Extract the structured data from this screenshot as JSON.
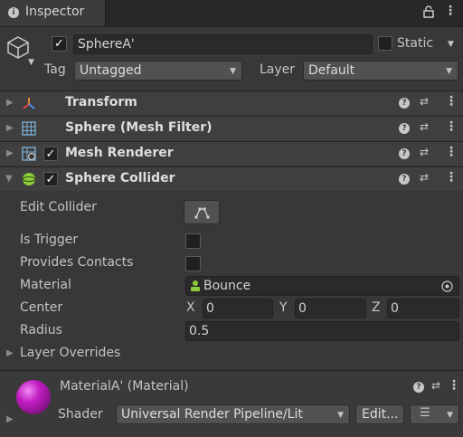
{
  "tab": {
    "title": "Inspector"
  },
  "object": {
    "name": "SphereA'",
    "active": true,
    "static_label": "Static",
    "tag_label": "Tag",
    "tag_value": "Untagged",
    "layer_label": "Layer",
    "layer_value": "Default"
  },
  "components": [
    {
      "title": "Transform",
      "expanded": false,
      "has_checkbox": false
    },
    {
      "title": "Sphere (Mesh Filter)",
      "expanded": false,
      "has_checkbox": false
    },
    {
      "title": "Mesh Renderer",
      "expanded": false,
      "has_checkbox": true,
      "enabled": true
    },
    {
      "title": "Sphere Collider",
      "expanded": true,
      "has_checkbox": true,
      "enabled": true
    }
  ],
  "collider": {
    "edit_collider_label": "Edit Collider",
    "is_trigger_label": "Is Trigger",
    "is_trigger": false,
    "provides_contacts_label": "Provides Contacts",
    "provides_contacts": false,
    "material_label": "Material",
    "material_value": "Bounce",
    "center_label": "Center",
    "center": {
      "x_label": "X",
      "x": "0",
      "y_label": "Y",
      "y": "0",
      "z_label": "Z",
      "z": "0"
    },
    "radius_label": "Radius",
    "radius": "0.5",
    "layer_overrides_label": "Layer Overrides"
  },
  "material": {
    "title": "MaterialA' (Material)",
    "shader_label": "Shader",
    "shader_value": "Universal Render Pipeline/Lit",
    "edit_label": "Edit...",
    "preview_color": "#c21ec4"
  },
  "colors": {
    "background": "#383838",
    "header": "#3f3f3f",
    "field": "#2a2a2a",
    "transform_icon_red": "#e0453a",
    "transform_icon_green": "#7ad33c",
    "transform_icon_blue": "#4e8ef0",
    "collider_icon": "#8ccd3a",
    "mesh_icon": "#7fb3d9"
  }
}
